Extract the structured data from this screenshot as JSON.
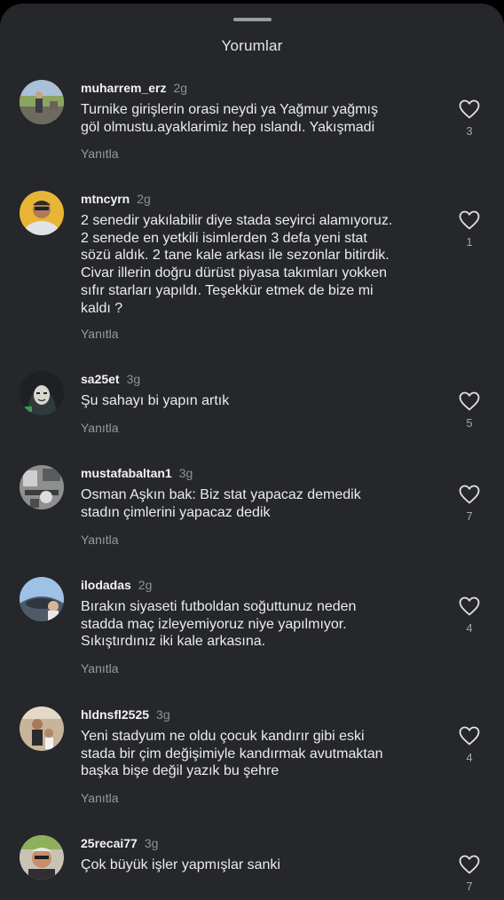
{
  "sheet": {
    "title": "Yorumlar"
  },
  "reply_label": "Yanıtla",
  "icons": {
    "like": "heart-outline-icon"
  },
  "comments": [
    {
      "username": "muharrem_erz",
      "time": "2g",
      "text": "Turnike girişlerin orasi neydi ya Yağmur yağmış\ngöl olmustu.ayaklarimiz hep ıslandı. Yakışmadi",
      "likes": "3"
    },
    {
      "username": "mtncyrn",
      "time": "2g",
      "text": "2 senedir yakılabilir diye stada seyirci alamıyoruz.\n2 senede en yetkili isimlerden 3 defa yeni stat\nsözü aldık. 2 tane kale arkası ile sezonlar bitirdik.\nCivar illerin doğru dürüst piyasa takımları yokken\nsıfır starları yapıldı. Teşekkür etmek de bize mi\nkaldı ?",
      "likes": "1"
    },
    {
      "username": "sa25et",
      "time": "3g",
      "text": "Şu sahayı bi yapın artık",
      "likes": "5"
    },
    {
      "username": "mustafabaltan1",
      "time": "3g",
      "text": "Osman Aşkın bak: Biz stat yapacaz demedik\nstadın çimlerini yapacaz dedik",
      "likes": "7"
    },
    {
      "username": "ilodadas",
      "time": "2g",
      "text": "Bırakın siyaseti futboldan soğuttunuz neden\nstadda maç izleyemiyoruz niye yapılmıyor.\nSıkıştırdınız iki kale arkasına.",
      "likes": "4"
    },
    {
      "username": "hldnsfl2525",
      "time": "3g",
      "text": "Yeni stadyum ne oldu çocuk kandırır gibi eski\nstada bir çim değişimiyle kandırmak avutmaktan\nbaşka bişe değil yazık bu şehre",
      "likes": "4"
    },
    {
      "username": "25recai77",
      "time": "3g",
      "text": "Çok büyük işler yapmışlar  sanki",
      "likes": "7"
    }
  ]
}
